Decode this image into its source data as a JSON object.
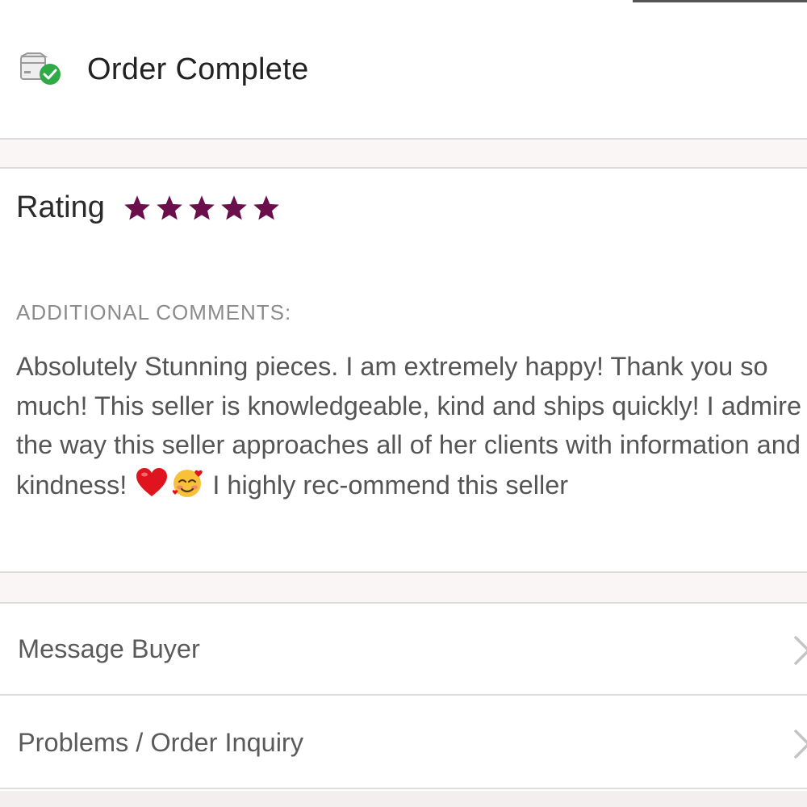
{
  "order": {
    "status_title": "Order Complete",
    "status_icon": "package-check-icon"
  },
  "rating": {
    "label": "Rating",
    "stars": 5,
    "max_stars": 5,
    "star_color": "#6b0f4c"
  },
  "comments": {
    "heading": "ADDITIONAL COMMENTS:",
    "text_before_emoji": "Absolutely Stunning pieces. I am extremely happy! Thank you so much! This seller is knowledgeable, kind and ships quickly! I admire the way this seller approaches all of her clients with information and kindness!",
    "emojis": [
      "red-heart-emoji",
      "smiling-face-with-hearts-emoji"
    ],
    "text_after_emoji": "I highly rec-ommend this seller"
  },
  "actions": {
    "message_buyer": "Message Buyer",
    "problems_inquiry": "Problems / Order Inquiry"
  },
  "colors": {
    "accent": "#6b0f4c",
    "success": "#2eaa47",
    "divider": "#dcdcdc"
  }
}
